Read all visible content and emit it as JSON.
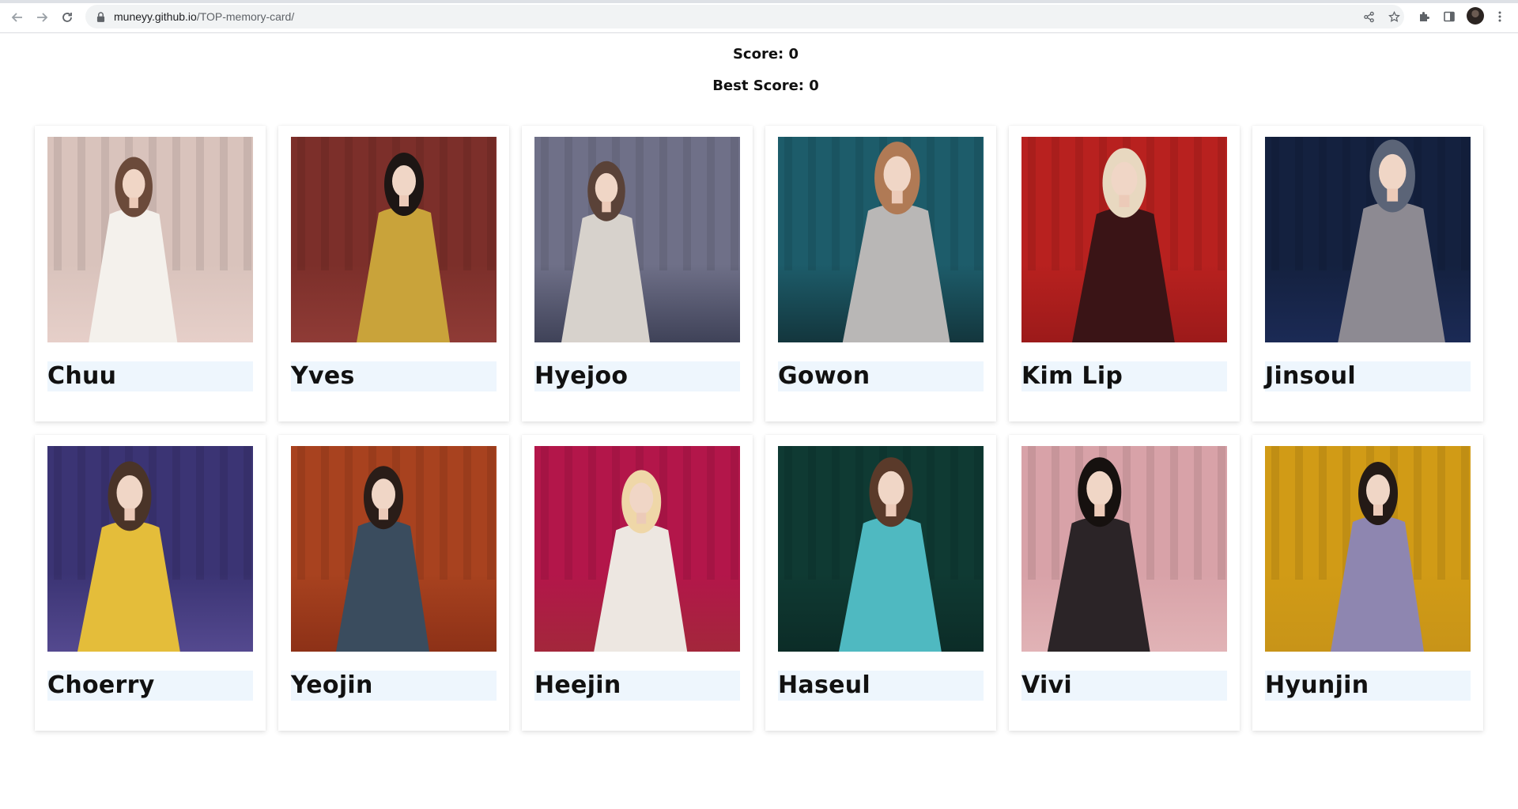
{
  "browser": {
    "url_host": "muneyy.github.io",
    "url_path": "/TOP-memory-card/",
    "icons": [
      "back-arrow-icon",
      "forward-arrow-icon",
      "reload-icon",
      "lock-icon",
      "share-icon",
      "star-icon",
      "extensions-icon",
      "side-panel-icon",
      "menu-dots-icon"
    ]
  },
  "scores": {
    "score_label": "Score:",
    "score_value": "0",
    "best_label": "Best Score:",
    "best_value": "0"
  },
  "cards": [
    {
      "name": "Chuu",
      "bg": "#d9c3bc",
      "floor": "#e6cfc9",
      "outfit": "#f4f1ec",
      "hair": "#6b4a3a"
    },
    {
      "name": "Yves",
      "bg": "#7c2f2a",
      "floor": "#8f3b36",
      "outfit": "#c9a33a",
      "hair": "#1d1614"
    },
    {
      "name": "Hyejoo",
      "bg": "#6f7088",
      "floor": "#3f4258",
      "outfit": "#d7d2cc",
      "hair": "#5a4238"
    },
    {
      "name": "Gowon",
      "bg": "#1d5c6a",
      "floor": "#13363d",
      "outfit": "#b9b7b6",
      "hair": "#b07a55"
    },
    {
      "name": "Kim Lip",
      "bg": "#b8211f",
      "floor": "#9c1a1a",
      "outfit": "#3a1416",
      "hair": "#e8d8c0"
    },
    {
      "name": "Jinsoul",
      "bg": "#14213f",
      "floor": "#1b2a55",
      "outfit": "#8d8a92",
      "hair": "#5b6477"
    },
    {
      "name": "Choerry",
      "bg": "#3b3474",
      "floor": "#54498f",
      "outfit": "#e4bd3a",
      "hair": "#4a3428"
    },
    {
      "name": "Yeojin",
      "bg": "#a8421f",
      "floor": "#8d3117",
      "outfit": "#3a4c5e",
      "hair": "#2a1d18"
    },
    {
      "name": "Heejin",
      "bg": "#b3164a",
      "floor": "#a3273b",
      "outfit": "#ede7e1",
      "hair": "#efd7a8"
    },
    {
      "name": "Haseul",
      "bg": "#0f3a33",
      "floor": "#0c2c27",
      "outfit": "#4fb9c1",
      "hair": "#5a3a2a"
    },
    {
      "name": "Vivi",
      "bg": "#d8a2a8",
      "floor": "#e1b3b6",
      "outfit": "#2b2427",
      "hair": "#16110f"
    },
    {
      "name": "Hyunjin",
      "bg": "#d19b16",
      "floor": "#c89418",
      "outfit": "#8e86b0",
      "hair": "#241a16"
    }
  ]
}
